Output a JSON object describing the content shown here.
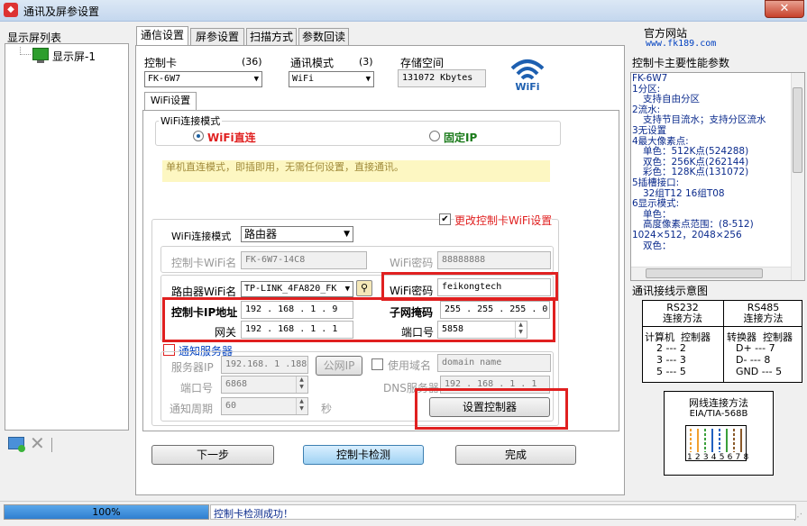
{
  "window": {
    "title": "通讯及屏参设置",
    "close": "✕"
  },
  "left_panel": {
    "header": "显示屏列表",
    "tree_item": "显示屏-1"
  },
  "tabs": [
    "通信设置",
    "屏参设置",
    "扫描方式",
    "参数回读"
  ],
  "top": {
    "card_label": "控制卡",
    "card_count": "(36)",
    "card_value": "FK-6W7",
    "mode_label": "通讯模式",
    "mode_count": "(3)",
    "mode_value": "WiFi",
    "storage_label": "存储空间",
    "storage_value": "131072 Kbytes"
  },
  "wifi_tab": "WiFi设置",
  "wifi_conn_group": {
    "title": "WiFi连接模式",
    "opt1": "WiFi直连",
    "opt2": "固定IP"
  },
  "info_text": "单机直连模式，即插即用，无需任何设置，直接通讯。",
  "settings": {
    "change_cb": "更改控制卡WiFi设置",
    "conn_mode_label": "WiFi连接模式",
    "conn_mode_value": "路由器",
    "card_wifi_label": "控制卡WiFi名",
    "card_wifi_value": "FK-6W7-14C8",
    "wifi_pwd_label_gray": "WiFi密码",
    "wifi_pwd_gray_value": "88888888",
    "router_wifi_label": "路由器WiFi名",
    "router_wifi_value": "TP-LINK_4FA820_FK",
    "wifi_pwd_label": "WiFi密码",
    "wifi_pwd_value": "feikongtech",
    "ip_label": "控制卡IP地址",
    "ip_value": "192 . 168 .  1  .  9",
    "gw_label": "网关",
    "gw_value": "192 . 168 .  1  .  1",
    "mask_label": "子网掩码",
    "mask_value": "255 . 255 . 255 .  0",
    "port_label": "端口号",
    "port_value": "5858",
    "notify_label": "通知服务器",
    "server_ip_label": "服务器IP",
    "server_ip_value": "192.168. 1 .188",
    "public_ip_btn": "公网IP",
    "use_domain_label": "使用域名",
    "domain_placeholder": "domain name",
    "port2_label": "端口号",
    "port2_value": "6868",
    "dns_label": "DNS服务器",
    "dns_value": "192 . 168 .  1  .  1",
    "period_label": "通知周期",
    "period_value": "60",
    "sec_label": "秒",
    "set_ctrl_btn": "设置控制器"
  },
  "buttons": {
    "next": "下一步",
    "detect": "控制卡检测",
    "done": "完成"
  },
  "right": {
    "site_label": "官方网站",
    "site_url": "www.fk189.com",
    "perf_title": "控制卡主要性能参数",
    "perf_lines": [
      {
        "text": "FK-6W7",
        "indent": 0
      },
      {
        "text": "1分区:",
        "indent": 0
      },
      {
        "text": "支持自由分区",
        "indent": 1
      },
      {
        "text": "2流水:",
        "indent": 0
      },
      {
        "text": "支持节目流水；支持分区流水",
        "indent": 1
      },
      {
        "text": "3无设置",
        "indent": 0
      },
      {
        "text": "4最大像素点:",
        "indent": 0
      },
      {
        "text": "单色：512K点(524288)",
        "indent": 1
      },
      {
        "text": "双色：256K点(262144)",
        "indent": 1
      },
      {
        "text": "彩色：128K点(131072)",
        "indent": 1
      },
      {
        "text": "5插槽接口:",
        "indent": 0
      },
      {
        "text": "32组T12  16组T08",
        "indent": 1
      },
      {
        "text": "6显示模式:",
        "indent": 0
      },
      {
        "text": "单色：",
        "indent": 1
      },
      {
        "text": "高度像素点范围：(8-512)",
        "indent": 1
      },
      {
        "text": "1024×512，2048×256",
        "indent": 0
      },
      {
        "text": "双色：",
        "indent": 1
      }
    ],
    "wiring_title": "通讯接线示意图",
    "rs232_title": "RS232",
    "rs232_sub": "连接方法",
    "rs485_title": "RS485",
    "rs485_sub": "连接方法",
    "rs232_cols": "计算机  控制器",
    "rs232_rows": [
      "2 --- 2",
      "3 --- 3",
      "5 --- 5"
    ],
    "rs485_cols": "转换器  控制器",
    "rs485_rows": [
      "D+ --- 7",
      "D- --- 8",
      "GND --- 5"
    ],
    "net_title": "网线连接方法",
    "net_std": "EIA/TIA-568B",
    "net_pins": "12345678"
  },
  "status": {
    "progress_text": "100%",
    "progress": 1.0,
    "message": "控制卡检测成功！"
  }
}
